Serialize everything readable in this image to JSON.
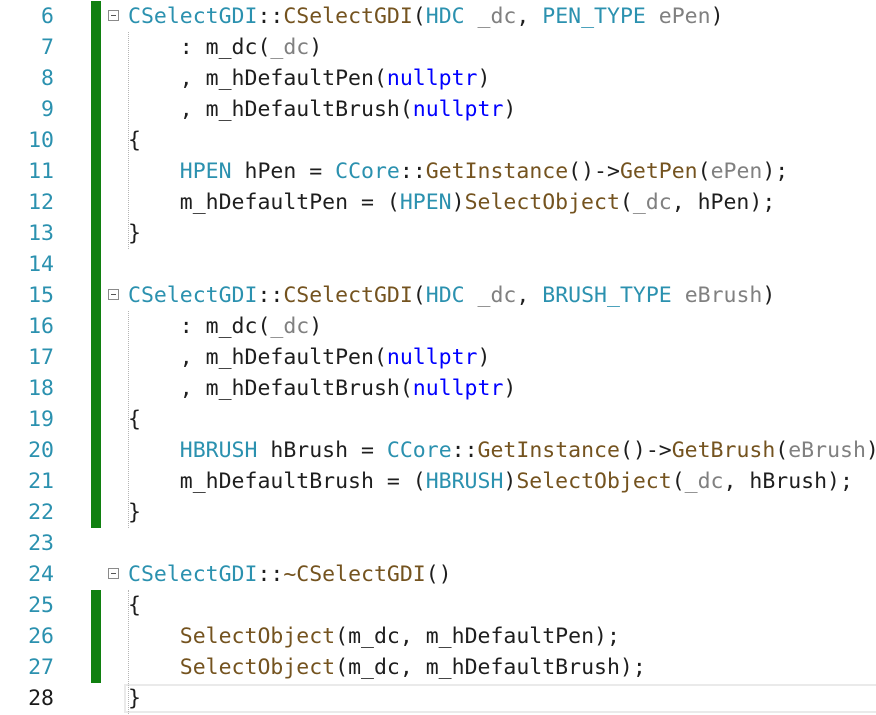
{
  "editor": {
    "current_line": 28,
    "lines": [
      {
        "num": "6",
        "changed": true,
        "fold": true,
        "tokens": [
          {
            "t": "CSelectGDI",
            "c": "class"
          },
          {
            "t": "::",
            "c": "plain"
          },
          {
            "t": "CSelectGDI",
            "c": "func"
          },
          {
            "t": "(",
            "c": "plain"
          },
          {
            "t": "HDC",
            "c": "class"
          },
          {
            "t": " ",
            "c": "plain"
          },
          {
            "t": "_dc",
            "c": "param"
          },
          {
            "t": ", ",
            "c": "plain"
          },
          {
            "t": "PEN_TYPE",
            "c": "class"
          },
          {
            "t": " ",
            "c": "plain"
          },
          {
            "t": "ePen",
            "c": "param"
          },
          {
            "t": ")",
            "c": "plain"
          }
        ]
      },
      {
        "num": "7",
        "changed": true,
        "tokens": [
          {
            "t": "    : m_dc(",
            "c": "plain"
          },
          {
            "t": "_dc",
            "c": "param"
          },
          {
            "t": ")",
            "c": "plain"
          }
        ]
      },
      {
        "num": "8",
        "changed": true,
        "tokens": [
          {
            "t": "    , m_hDefaultPen(",
            "c": "plain"
          },
          {
            "t": "nullptr",
            "c": "kw"
          },
          {
            "t": ")",
            "c": "plain"
          }
        ]
      },
      {
        "num": "9",
        "changed": true,
        "tokens": [
          {
            "t": "    , m_hDefaultBrush(",
            "c": "plain"
          },
          {
            "t": "nullptr",
            "c": "kw"
          },
          {
            "t": ")",
            "c": "plain"
          }
        ]
      },
      {
        "num": "10",
        "changed": true,
        "tokens": [
          {
            "t": "{",
            "c": "plain"
          }
        ]
      },
      {
        "num": "11",
        "changed": true,
        "tokens": [
          {
            "t": "    ",
            "c": "plain"
          },
          {
            "t": "HPEN",
            "c": "class"
          },
          {
            "t": " ",
            "c": "plain"
          },
          {
            "t": "hPen",
            "c": "local"
          },
          {
            "t": " = ",
            "c": "plain"
          },
          {
            "t": "CCore",
            "c": "class"
          },
          {
            "t": "::",
            "c": "plain"
          },
          {
            "t": "GetInstance",
            "c": "func"
          },
          {
            "t": "()->",
            "c": "plain"
          },
          {
            "t": "GetPen",
            "c": "func"
          },
          {
            "t": "(",
            "c": "plain"
          },
          {
            "t": "ePen",
            "c": "param"
          },
          {
            "t": ");",
            "c": "plain"
          }
        ]
      },
      {
        "num": "12",
        "changed": true,
        "tokens": [
          {
            "t": "    m_hDefaultPen = (",
            "c": "plain"
          },
          {
            "t": "HPEN",
            "c": "class"
          },
          {
            "t": ")",
            "c": "plain"
          },
          {
            "t": "SelectObject",
            "c": "func"
          },
          {
            "t": "(",
            "c": "plain"
          },
          {
            "t": "_dc",
            "c": "param"
          },
          {
            "t": ", ",
            "c": "plain"
          },
          {
            "t": "hPen",
            "c": "local"
          },
          {
            "t": ");",
            "c": "plain"
          }
        ]
      },
      {
        "num": "13",
        "changed": true,
        "tokens": [
          {
            "t": "}",
            "c": "plain"
          }
        ]
      },
      {
        "num": "14",
        "changed": true,
        "tokens": []
      },
      {
        "num": "15",
        "changed": true,
        "fold": true,
        "tokens": [
          {
            "t": "CSelectGDI",
            "c": "class"
          },
          {
            "t": "::",
            "c": "plain"
          },
          {
            "t": "CSelectGDI",
            "c": "func"
          },
          {
            "t": "(",
            "c": "plain"
          },
          {
            "t": "HDC",
            "c": "class"
          },
          {
            "t": " ",
            "c": "plain"
          },
          {
            "t": "_dc",
            "c": "param"
          },
          {
            "t": ", ",
            "c": "plain"
          },
          {
            "t": "BRUSH_TYPE",
            "c": "class"
          },
          {
            "t": " ",
            "c": "plain"
          },
          {
            "t": "eBrush",
            "c": "param"
          },
          {
            "t": ")",
            "c": "plain"
          }
        ]
      },
      {
        "num": "16",
        "changed": true,
        "tokens": [
          {
            "t": "    : m_dc(",
            "c": "plain"
          },
          {
            "t": "_dc",
            "c": "param"
          },
          {
            "t": ")",
            "c": "plain"
          }
        ]
      },
      {
        "num": "17",
        "changed": true,
        "tokens": [
          {
            "t": "    , m_hDefaultPen(",
            "c": "plain"
          },
          {
            "t": "nullptr",
            "c": "kw"
          },
          {
            "t": ")",
            "c": "plain"
          }
        ]
      },
      {
        "num": "18",
        "changed": true,
        "tokens": [
          {
            "t": "    , m_hDefaultBrush(",
            "c": "plain"
          },
          {
            "t": "nullptr",
            "c": "kw"
          },
          {
            "t": ")",
            "c": "plain"
          }
        ]
      },
      {
        "num": "19",
        "changed": true,
        "tokens": [
          {
            "t": "{",
            "c": "plain"
          }
        ]
      },
      {
        "num": "20",
        "changed": true,
        "tokens": [
          {
            "t": "    ",
            "c": "plain"
          },
          {
            "t": "HBRUSH",
            "c": "class"
          },
          {
            "t": " ",
            "c": "plain"
          },
          {
            "t": "hBrush",
            "c": "local"
          },
          {
            "t": " = ",
            "c": "plain"
          },
          {
            "t": "CCore",
            "c": "class"
          },
          {
            "t": "::",
            "c": "plain"
          },
          {
            "t": "GetInstance",
            "c": "func"
          },
          {
            "t": "()->",
            "c": "plain"
          },
          {
            "t": "GetBrush",
            "c": "func"
          },
          {
            "t": "(",
            "c": "plain"
          },
          {
            "t": "eBrush",
            "c": "param"
          },
          {
            "t": ");",
            "c": "plain"
          }
        ]
      },
      {
        "num": "21",
        "changed": true,
        "tokens": [
          {
            "t": "    m_hDefaultBrush = (",
            "c": "plain"
          },
          {
            "t": "HBRUSH",
            "c": "class"
          },
          {
            "t": ")",
            "c": "plain"
          },
          {
            "t": "SelectObject",
            "c": "func"
          },
          {
            "t": "(",
            "c": "plain"
          },
          {
            "t": "_dc",
            "c": "param"
          },
          {
            "t": ", ",
            "c": "plain"
          },
          {
            "t": "hBrush",
            "c": "local"
          },
          {
            "t": ");",
            "c": "plain"
          }
        ]
      },
      {
        "num": "22",
        "changed": true,
        "tokens": [
          {
            "t": "}",
            "c": "plain"
          }
        ]
      },
      {
        "num": "23",
        "changed": false,
        "tokens": []
      },
      {
        "num": "24",
        "changed": false,
        "fold": true,
        "tokens": [
          {
            "t": "CSelectGDI",
            "c": "class"
          },
          {
            "t": "::",
            "c": "plain"
          },
          {
            "t": "~CSelectGDI",
            "c": "func"
          },
          {
            "t": "()",
            "c": "plain"
          }
        ]
      },
      {
        "num": "25",
        "changed": true,
        "tokens": [
          {
            "t": "{",
            "c": "plain"
          }
        ]
      },
      {
        "num": "26",
        "changed": true,
        "tokens": [
          {
            "t": "    ",
            "c": "plain"
          },
          {
            "t": "SelectObject",
            "c": "func"
          },
          {
            "t": "(m_dc, m_hDefaultPen);",
            "c": "plain"
          }
        ]
      },
      {
        "num": "27",
        "changed": true,
        "tokens": [
          {
            "t": "    ",
            "c": "plain"
          },
          {
            "t": "SelectObject",
            "c": "func"
          },
          {
            "t": "(m_dc, m_hDefaultBrush);",
            "c": "plain"
          }
        ]
      },
      {
        "num": "28",
        "changed": false,
        "tokens": [
          {
            "t": "}",
            "c": "plain"
          }
        ]
      }
    ]
  },
  "colors": {
    "class": "#2b91af",
    "func": "#74531f",
    "param": "#808080",
    "keyword": "#0000ff",
    "change_bar": "#108010",
    "line_number": "#2b91af"
  }
}
